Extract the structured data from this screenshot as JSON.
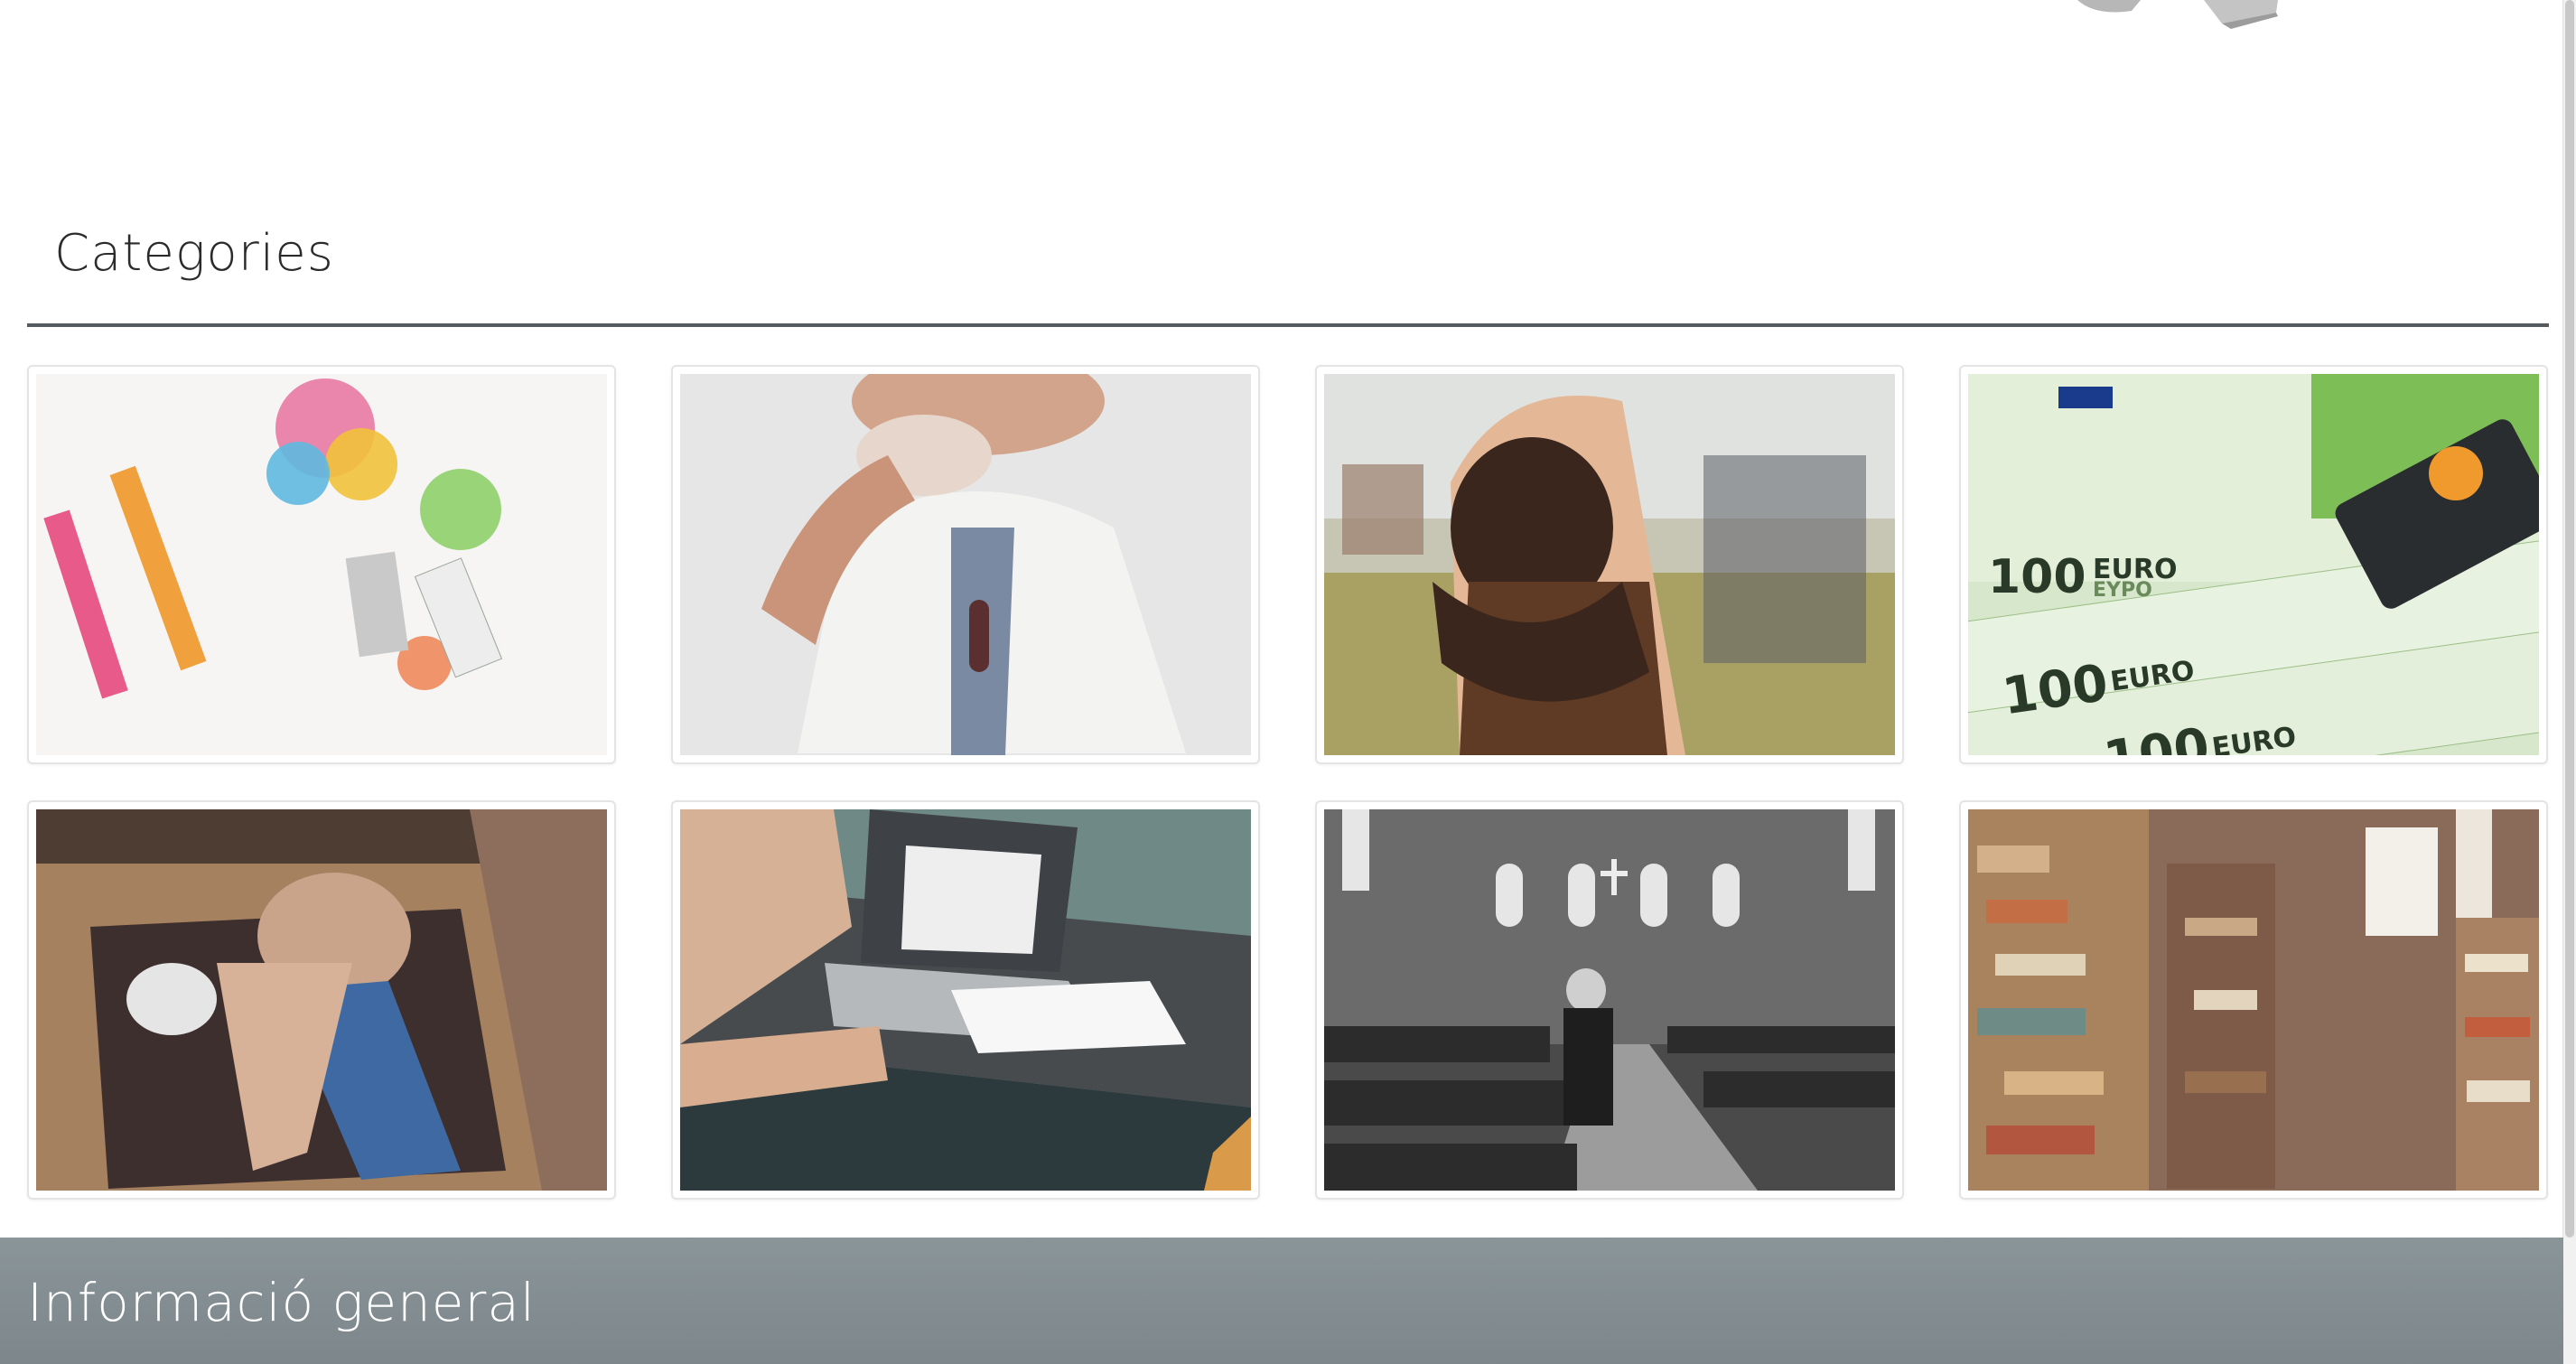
{
  "categories_section": {
    "title": "Categories",
    "items": [
      {
        "image": "colorful-sprinkles-razor-photo"
      },
      {
        "image": "man-eating-donut-photo"
      },
      {
        "image": "woman-hugging-child-photo"
      },
      {
        "image": "euro-banknotes-photo",
        "banknote_text": [
          "100",
          "EURO",
          "EYPO",
          "100",
          "EURO",
          "100",
          "EURO"
        ]
      },
      {
        "image": "couple-lying-on-rug-photo"
      },
      {
        "image": "laptop-notebook-desk-photo"
      },
      {
        "image": "man-in-church-photo"
      },
      {
        "image": "stacked-books-library-photo"
      }
    ]
  },
  "footer": {
    "title": "Informació general"
  },
  "colors": {
    "rule": "#555b5e",
    "footer_band": "#838d91",
    "card_border": "#e4e4e4"
  }
}
